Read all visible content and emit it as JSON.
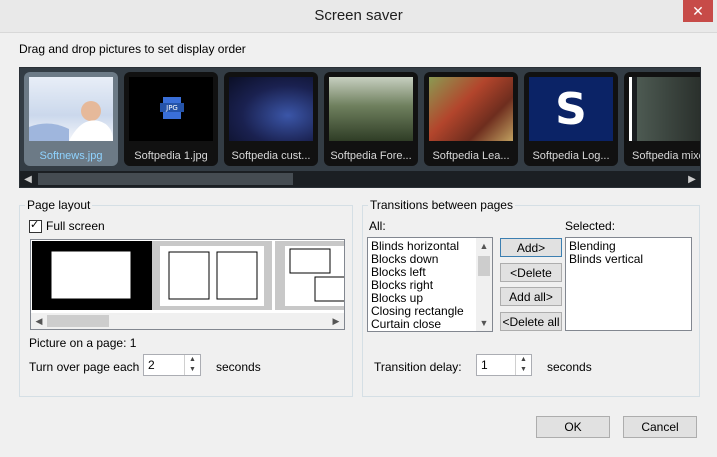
{
  "window": {
    "title": "Screen saver",
    "close_glyph": "✕"
  },
  "instruction": "Drag and drop pictures to set display order",
  "thumbnails": [
    {
      "caption": "Softnews.jpg",
      "selected": true,
      "color": "#dfe8f5"
    },
    {
      "caption": "Softpedia 1.jpg",
      "selected": false,
      "color": "#000000"
    },
    {
      "caption": "Softpedia cust...",
      "selected": false,
      "color": "#1d2a5c"
    },
    {
      "caption": "Softpedia Fore...",
      "selected": false,
      "color": "#4b5d3f"
    },
    {
      "caption": "Softpedia Lea...",
      "selected": false,
      "color": "#7a4a2f"
    },
    {
      "caption": "Softpedia Log...",
      "selected": false,
      "color": "#0a1e5a"
    },
    {
      "caption": "Softpedia mixe",
      "selected": false,
      "color": "#2c3238"
    }
  ],
  "jpg_badge": "JPG",
  "logo_letter": "S",
  "page_layout": {
    "label": "Page layout",
    "full_screen_label": "Full screen",
    "full_screen_checked": true,
    "picture_on_page": "Picture on a page: 1",
    "turn_over_label": "Turn over page each",
    "turn_over_value": "2",
    "seconds_label": "seconds"
  },
  "transitions": {
    "label": "Transitions between pages",
    "all_label": "All:",
    "selected_label": "Selected:",
    "all_items": [
      "Blinds horizontal",
      "Blocks down",
      "Blocks left",
      "Blocks right",
      "Blocks up",
      "Closing rectangle",
      "Curtain close"
    ],
    "selected_items": [
      "Blending",
      "Blinds vertical"
    ],
    "add_label": "Add>",
    "delete_label": "<Delete",
    "add_all_label": "Add all>",
    "delete_all_label": "<Delete all",
    "delay_label": "Transition delay:",
    "delay_value": "1",
    "seconds_label": "seconds"
  },
  "footer": {
    "ok_label": "OK",
    "cancel_label": "Cancel"
  }
}
